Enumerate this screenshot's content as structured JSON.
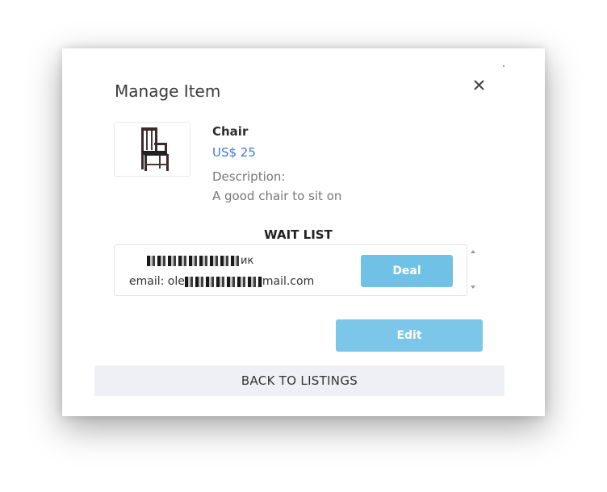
{
  "modal": {
    "title": "Manage Item",
    "close_icon": "close-icon"
  },
  "item": {
    "name": "Chair",
    "price": "US$ 25",
    "description_label": "Description:",
    "description": "A good chair to sit on",
    "image_icon": "chair-icon"
  },
  "wait_list": {
    "title": "WAIT LIST",
    "entries": [
      {
        "name_suffix": "ик",
        "email_prefix": "email: ole",
        "email_suffix": "mail.com",
        "deal_label": "Deal"
      }
    ]
  },
  "actions": {
    "edit_label": "Edit",
    "back_label": "BACK TO LISTINGS"
  },
  "colors": {
    "accent": "#6fc1e6",
    "price": "#3c7ad8",
    "back_bg": "#eef0f5"
  }
}
